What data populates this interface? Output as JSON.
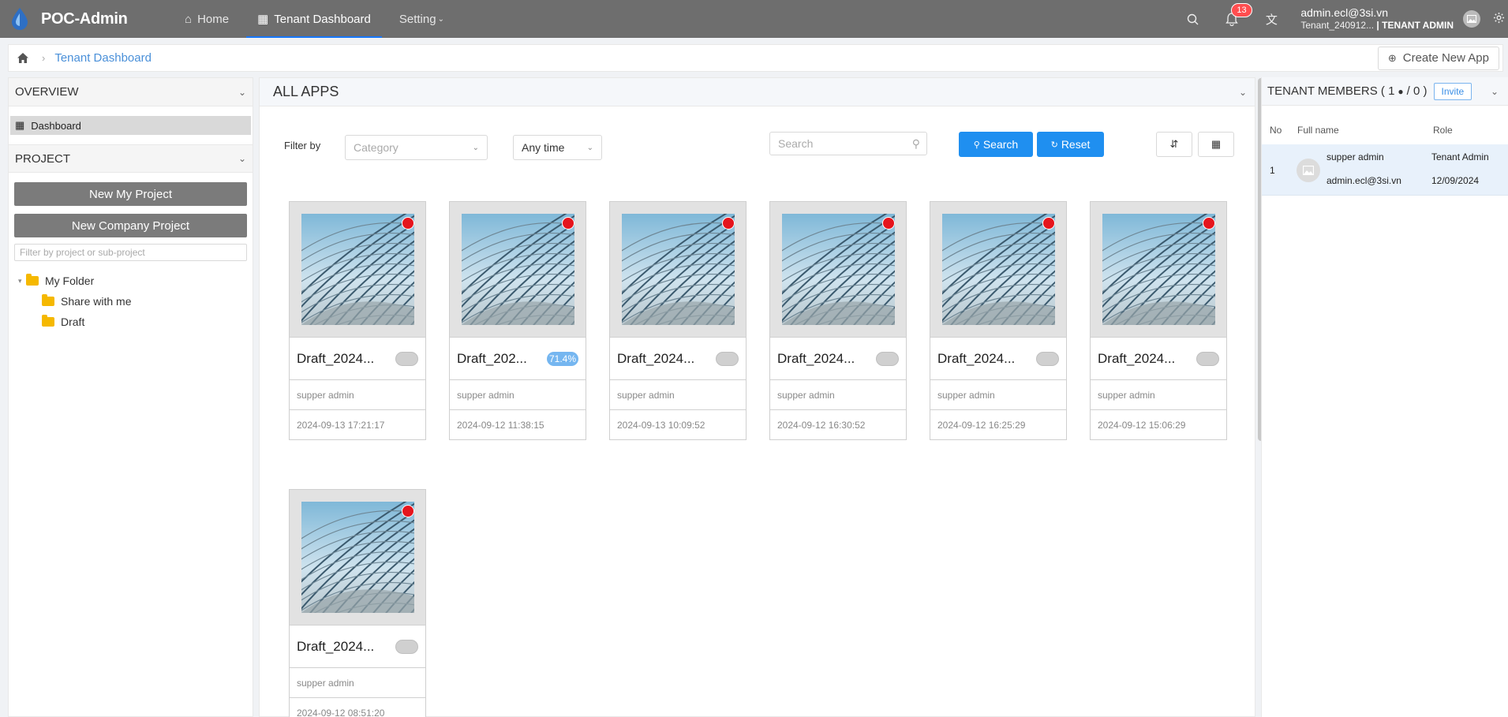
{
  "app": {
    "title": "POC-Admin"
  },
  "nav": {
    "home": "Home",
    "tenant_dashboard": "Tenant Dashboard",
    "setting": "Setting"
  },
  "header": {
    "notifications_count": "13",
    "user_email": "admin.ecl@3si.vn",
    "tenant_name": "Tenant_240912...",
    "role_label": "| TENANT ADMIN"
  },
  "breadcrumb": {
    "current": "Tenant Dashboard"
  },
  "actions": {
    "create_new_app": "Create New App"
  },
  "sidebar": {
    "overview_title": "OVERVIEW",
    "dashboard_label": "Dashboard",
    "project_title": "PROJECT",
    "new_my_project": "New My Project",
    "new_company_project": "New Company Project",
    "filter_placeholder": "Filter by project or sub-project",
    "tree": {
      "root": "My Folder",
      "children": [
        "Share with me",
        "Draft"
      ]
    }
  },
  "main": {
    "title": "ALL APPS",
    "filter_label": "Filter by",
    "category_placeholder": "Category",
    "time_value": "Any time",
    "search_placeholder": "Search",
    "search_button": "Search",
    "reset_button": "Reset",
    "apps": [
      {
        "name": "Draft_2024...",
        "owner": "supper admin",
        "date": "2024-09-13 17:21:17",
        "status": "toggle"
      },
      {
        "name": "Draft_202...",
        "owner": "supper admin",
        "date": "2024-09-12 11:38:15",
        "status": "71.4%"
      },
      {
        "name": "Draft_2024...",
        "owner": "supper admin",
        "date": "2024-09-13 10:09:52",
        "status": "toggle"
      },
      {
        "name": "Draft_2024...",
        "owner": "supper admin",
        "date": "2024-09-12 16:30:52",
        "status": "toggle"
      },
      {
        "name": "Draft_2024...",
        "owner": "supper admin",
        "date": "2024-09-12 16:25:29",
        "status": "toggle"
      },
      {
        "name": "Draft_2024...",
        "owner": "supper admin",
        "date": "2024-09-12 15:06:29",
        "status": "toggle"
      },
      {
        "name": "Draft_2024...",
        "owner": "supper admin",
        "date": "2024-09-12 08:51:20",
        "status": "toggle"
      }
    ]
  },
  "members": {
    "title_prefix": "TENANT MEMBERS ( 1",
    "title_suffix": "/ 0 )",
    "invite": "Invite",
    "columns": {
      "no": "No",
      "full_name": "Full name",
      "role": "Role"
    },
    "rows": [
      {
        "no": "1",
        "name": "supper admin",
        "email": "admin.ecl@3si.vn",
        "role": "Tenant Admin",
        "date": "12/09/2024"
      }
    ]
  },
  "colors": {
    "topbar": "#6e6e6e",
    "accent": "#1f8ff0",
    "badge": "#ff4d4f",
    "folder": "#f5b800"
  }
}
